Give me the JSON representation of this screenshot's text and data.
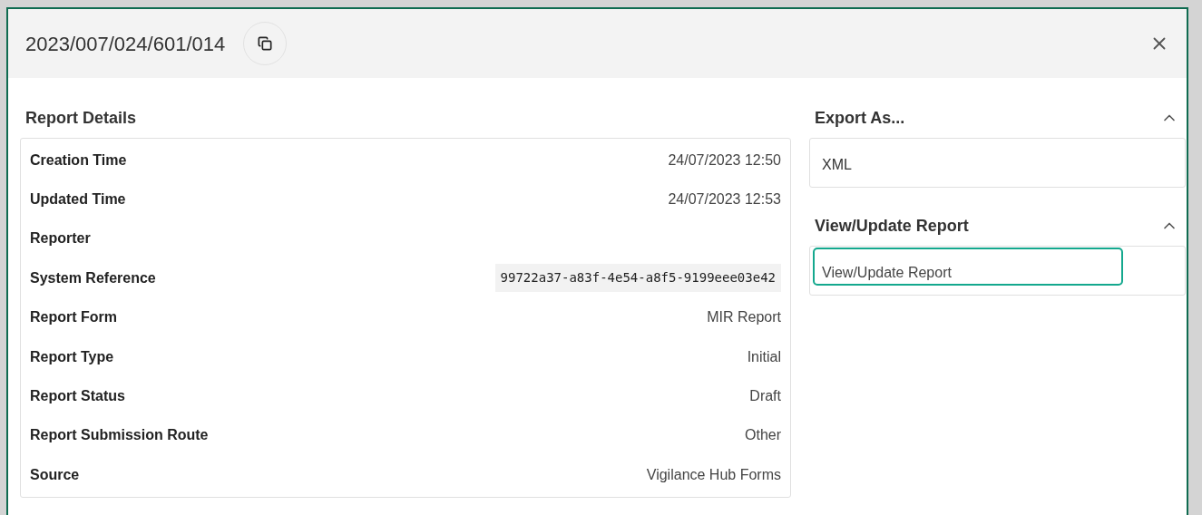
{
  "dialog": {
    "title": "2023/007/024/601/014"
  },
  "report_details": {
    "heading": "Report Details",
    "rows": [
      {
        "label": "Creation Time",
        "value": "24/07/2023 12:50",
        "kind": "text"
      },
      {
        "label": "Updated Time",
        "value": "24/07/2023 12:53",
        "kind": "text"
      },
      {
        "label": "Reporter",
        "kind": "text"
      },
      {
        "label": "System Reference",
        "value": "99722a37-a83f-4e54-a8f5-9199eee03e42",
        "kind": "code"
      },
      {
        "label": "Report Form",
        "value": "MIR Report",
        "kind": "text"
      },
      {
        "label": "Report Type",
        "value": "Initial",
        "kind": "text"
      },
      {
        "label": "Report Status",
        "value": "Draft",
        "kind": "text"
      },
      {
        "label": "Report Submission Route",
        "value": "Other",
        "kind": "text"
      },
      {
        "label": "Source",
        "value": "Vigilance Hub Forms",
        "kind": "text"
      }
    ]
  },
  "sections": [
    {
      "heading": "Export As...",
      "expanded": true,
      "items": [
        {
          "label": "XML",
          "focused": false
        }
      ]
    },
    {
      "heading": "View/Update Report",
      "expanded": true,
      "items": [
        {
          "label": "View/Update Report",
          "focused": true
        }
      ]
    }
  ]
}
